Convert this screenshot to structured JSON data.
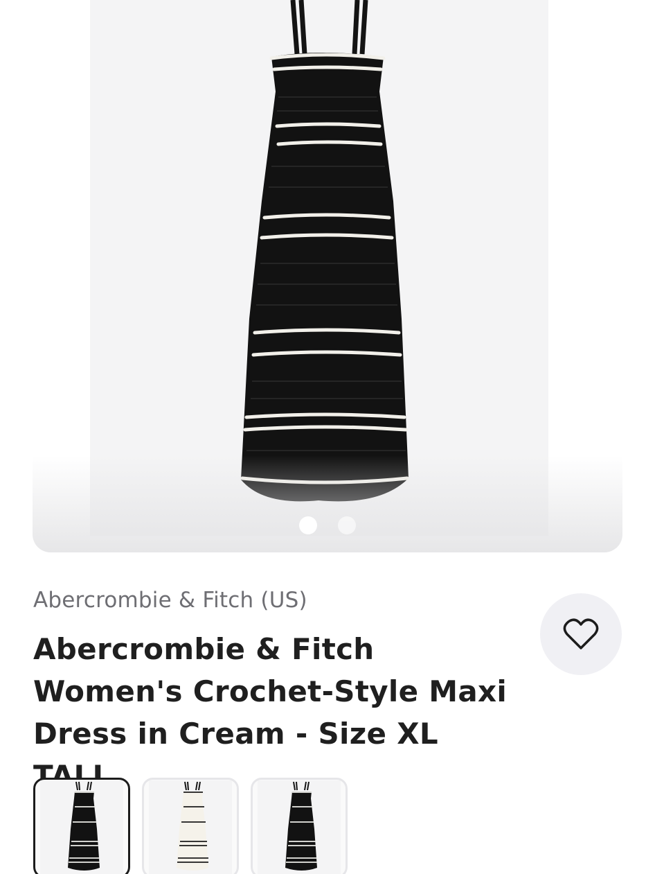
{
  "banner": {
    "color": "#e0202a"
  },
  "gallery": {
    "image": "black crochet-style maxi dress with white stripes",
    "slide_count": 2,
    "active_slide": 1
  },
  "product": {
    "seller": "Abercrombie & Fitch (US)",
    "title": "Abercrombie & Fitch Women's Crochet-Style Maxi Dress in Cream - Size XL TALL"
  },
  "favorite": {
    "icon": "heart-outline-icon"
  },
  "thumbnails": [
    {
      "image": "black dress with white stripes",
      "selected": true
    },
    {
      "image": "cream dress with black stripes",
      "selected": false
    },
    {
      "image": "black dress with white stripes",
      "selected": false
    }
  ]
}
